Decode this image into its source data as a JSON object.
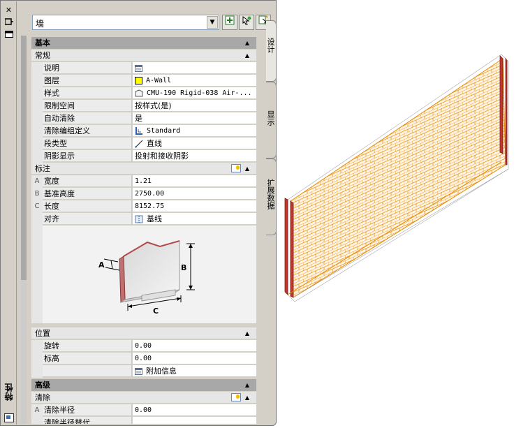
{
  "palette": {
    "title": "特性",
    "close_glyph": "✕",
    "selector_value": "墙",
    "tabs": [
      "设计",
      "显示",
      "扩展数据"
    ]
  },
  "categories": {
    "basic": "基本",
    "advanced": "高级"
  },
  "general": {
    "header": "常规",
    "rows": [
      {
        "label": "说明",
        "value": ""
      },
      {
        "label": "图层",
        "value": "A-Wall"
      },
      {
        "label": "样式",
        "value": "CMU-190 Rigid-038 Air-..."
      },
      {
        "label": "限制空间",
        "value": "按样式(是)"
      },
      {
        "label": "自动清除",
        "value": "是"
      },
      {
        "label": "清除编组定义",
        "value": "Standard"
      },
      {
        "label": "段类型",
        "value": "直线"
      },
      {
        "label": "阴影显示",
        "value": "投射和接收阴影"
      }
    ]
  },
  "dimensions": {
    "header": "标注",
    "rows": [
      {
        "key": "A",
        "label": "宽度",
        "value": "1.21"
      },
      {
        "key": "B",
        "label": "基准高度",
        "value": "2750.00"
      },
      {
        "key": "C",
        "label": "长度",
        "value": "8152.75"
      },
      {
        "key": "",
        "label": "对齐",
        "value": "基线"
      }
    ],
    "diagram_labels": {
      "a": "A",
      "b": "B",
      "c": "C"
    }
  },
  "location": {
    "header": "位置",
    "rows": [
      {
        "label": "旋转",
        "value": "0.00"
      },
      {
        "label": "标高",
        "value": "0.00"
      }
    ],
    "extra_info": "附加信息"
  },
  "cleanup": {
    "header": "清除",
    "rows": [
      {
        "key": "A",
        "label": "清除半径",
        "value": "0.00"
      },
      {
        "key": "",
        "label": "清除半径替代",
        "value": ""
      }
    ]
  },
  "colors": {
    "layer_swatch": "#ffff00",
    "wall_lines": "#e58a00",
    "wall_cap": "#b02020"
  }
}
